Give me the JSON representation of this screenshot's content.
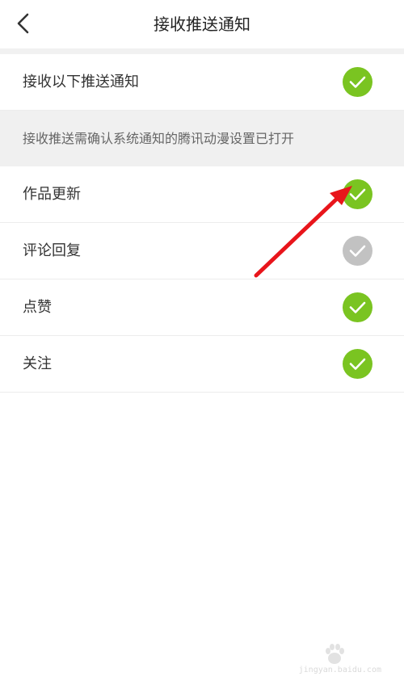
{
  "header": {
    "title": "接收推送通知",
    "back_icon": "chevron-left-icon"
  },
  "master_toggle": {
    "label": "接收以下推送通知",
    "enabled": true
  },
  "note": {
    "text": "接收推送需确认系统通知的腾讯动漫设置已打开"
  },
  "items": [
    {
      "label": "作品更新",
      "enabled": true
    },
    {
      "label": "评论回复",
      "enabled": false
    },
    {
      "label": "点赞",
      "enabled": true
    },
    {
      "label": "关注",
      "enabled": true
    }
  ],
  "colors": {
    "check_on": "#7ac421",
    "check_off": "#c2c2c2",
    "annotation_arrow": "#e8151b"
  },
  "watermark": {
    "text": "jingyan.baidu.com",
    "logo_text": "Bai 经验"
  }
}
